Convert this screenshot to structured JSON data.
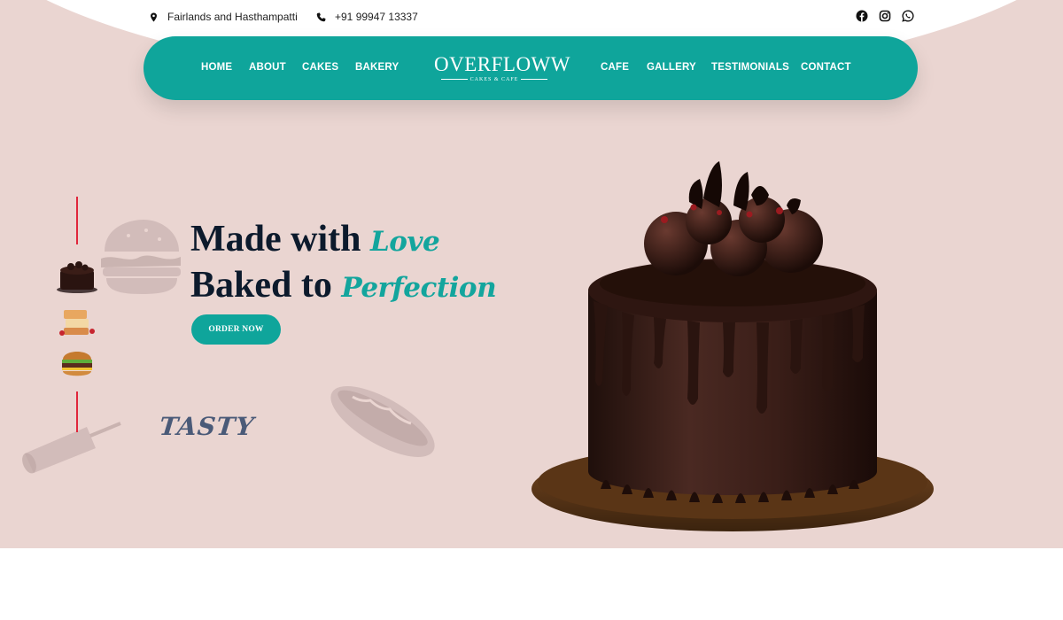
{
  "topbar": {
    "location_icon": "map-pin-icon",
    "location": "Fairlands and Hasthampatti",
    "phone_icon": "phone-icon",
    "phone": "+91 99947 13337",
    "social": [
      "facebook-icon",
      "instagram-icon",
      "whatsapp-icon"
    ]
  },
  "nav": {
    "left": [
      "HOME",
      "ABOUT",
      "CAKES",
      "BAKERY"
    ],
    "right": [
      "CAFE",
      "GALLERY",
      "TESTIMONIALS",
      "CONTACT"
    ],
    "logo_main": "OVERFLOWW",
    "logo_sub": "CAKES & CAFE"
  },
  "hero": {
    "line1_a": "Made with ",
    "line1_b": "Love",
    "line2_a": "Baked to ",
    "line2_b": "Perfection",
    "cta": "ORDER NOW",
    "tasty": "TASTY"
  },
  "colors": {
    "brand_teal": "#0fa59b",
    "hero_bg": "#ead5d1",
    "heading": "#0c1a2c",
    "accent_red": "#e0263b"
  }
}
